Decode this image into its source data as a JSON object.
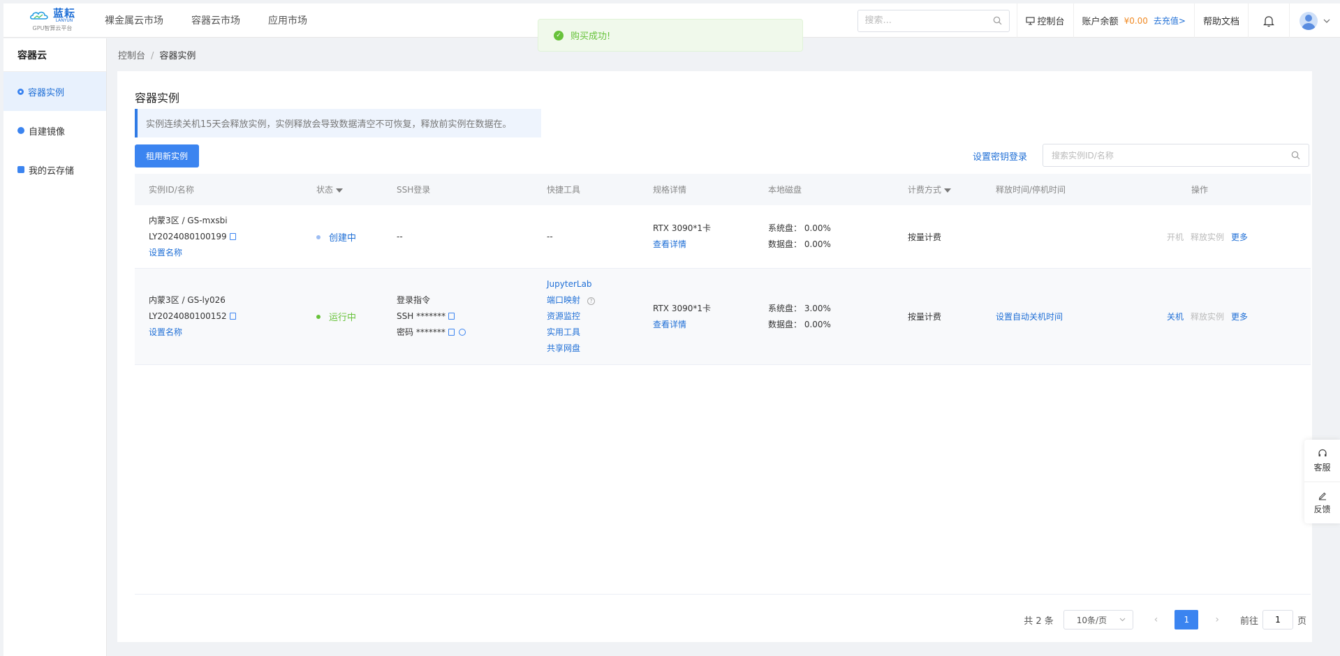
{
  "brand": {
    "name_cn": "蓝耘",
    "name_en": "LANYUN",
    "sub": "GPU智算云平台"
  },
  "nav": [
    "裸金属云市场",
    "容器云市场",
    "应用市场"
  ],
  "search": {
    "placeholder": "搜索..."
  },
  "topbar": {
    "console": "控制台",
    "balance_label": "账户余额",
    "balance_value": "¥0.00",
    "recharge": "去充值>",
    "help": "帮助文档"
  },
  "toast": {
    "message": "购买成功!"
  },
  "sidebar": {
    "title": "容器云",
    "items": [
      {
        "label": "容器实例"
      },
      {
        "label": "自建镜像"
      },
      {
        "label": "我的云存储"
      }
    ]
  },
  "breadcrumb": {
    "root": "控制台",
    "sep": "/",
    "current": "容器实例"
  },
  "page": {
    "title": "容器实例",
    "notice": "实例连续关机15天会释放实例，实例释放会导致数据清空不可恢复，释放前实例在数据在。",
    "rent_button": "租用新实例",
    "ssh_key_link": "设置密钥登录",
    "instance_search_placeholder": "搜索实例ID/名称"
  },
  "table": {
    "headers": [
      "实例ID/名称",
      "状态",
      "SSH登录",
      "快捷工具",
      "规格详情",
      "本地磁盘",
      "计费方式",
      "释放时间/停机时间",
      "操作"
    ],
    "rows": [
      {
        "region": "内蒙3区 / GS-mxsbi",
        "id": "LY2024080100199",
        "set_name": "设置名称",
        "status": "创建中",
        "ssh": "--",
        "tools": "--",
        "spec": "RTX 3090*1卡",
        "spec_detail": "查看详情",
        "sys_disk": "系统盘：  0.00%",
        "data_disk": "数据盘：  0.00%",
        "billing": "按量计费",
        "release": "",
        "ops": [
          "开机",
          "释放实例",
          "更多"
        ]
      },
      {
        "region": "内蒙3区 / GS-ly026",
        "id": "LY2024080100152",
        "set_name": "设置名称",
        "status": "运行中",
        "ssh_cmd": "登录指令",
        "ssh_user": "SSH *******",
        "ssh_pwd": "密码 *******",
        "tools": [
          "JupyterLab",
          "端口映射",
          "资源监控",
          "实用工具",
          "共享网盘"
        ],
        "spec": "RTX 3090*1卡",
        "spec_detail": "查看详情",
        "sys_disk": "系统盘：  3.00%",
        "data_disk": "数据盘：  0.00%",
        "billing": "按量计费",
        "release": "设置自动关机时间",
        "ops": [
          "关机",
          "释放实例",
          "更多"
        ]
      }
    ]
  },
  "pagination": {
    "total": "共 2 条",
    "page_size": "10条/页",
    "current": "1",
    "goto_prefix": "前往",
    "goto_value": "1",
    "goto_suffix": "页"
  },
  "float": {
    "service": "客服",
    "feedback": "反馈"
  },
  "colors": {
    "primary": "#3b84f0",
    "link": "#1f6fd6",
    "success": "#67c23a",
    "balance": "#f08a24"
  }
}
